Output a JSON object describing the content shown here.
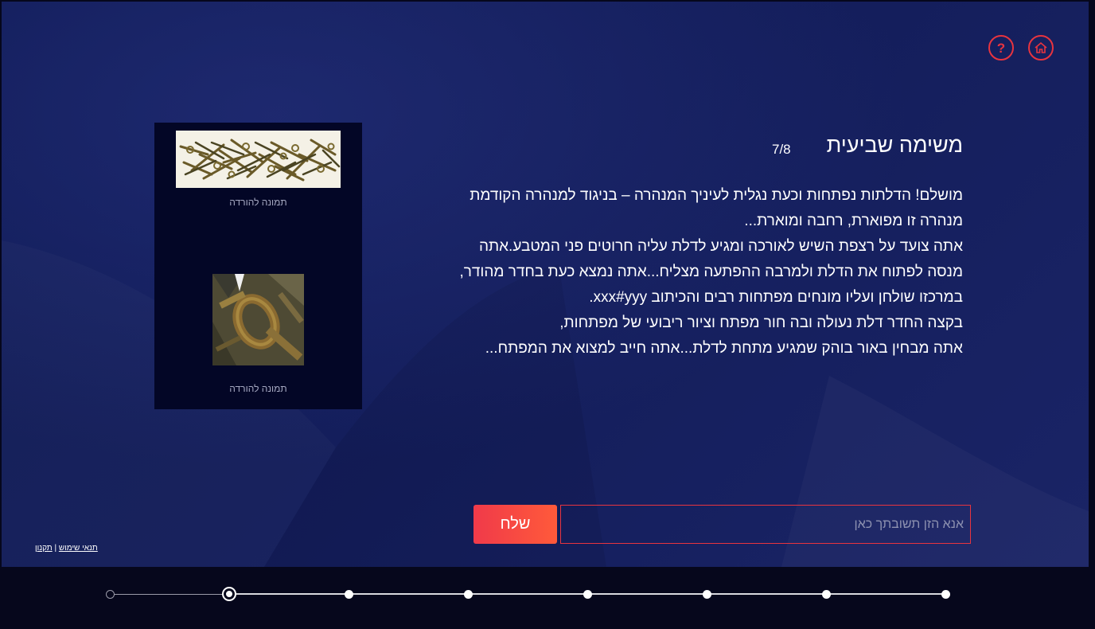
{
  "header": {
    "help_icon": "question-mark-icon",
    "home_icon": "home-icon"
  },
  "task": {
    "title": "משימה שביעית",
    "progress": "7/8",
    "paragraphs": [
      "מושלם! הדלתות נפתחות וכעת נגלית לעיניך המנהרה – בניגוד למנהרה הקודמת מנהרה זו מפוארת, רחבה ומוארת...",
      "אתה צועד על רצפת השיש לאורכה ומגיע לדלת עליה חרוטים פני המטבע.אתה מנסה לפתוח את הדלת ולמרבה ההפתעה מצליח...אתה נמצא כעת בחדר מהודר, במרכזו שולחן ועליו מונחים מפתחות רבים והכיתוב xxx#yyy.",
      "בקצה החדר דלת נעולה ובה חור מפתח וציור ריבועי של מפתחות,",
      "אתה מבחין באור בוהק שמגיע מתחת לדלת...אתה חייב למצוא את המפתח..."
    ]
  },
  "images": [
    {
      "caption": "תמונה להורדה"
    },
    {
      "caption": "תמונה להורדה"
    }
  ],
  "answer": {
    "placeholder": "אנא הזן תשובתך כאן",
    "value": "",
    "send_label": "שלח"
  },
  "footer": {
    "terms_label": "תנאי שימוש",
    "separator": "|",
    "rules_label": "תקנון"
  },
  "timeline": {
    "total_steps": 8,
    "current_step": 2
  },
  "colors": {
    "accent": "#e8343f",
    "background": "#131d5a",
    "panel": "#030626"
  }
}
